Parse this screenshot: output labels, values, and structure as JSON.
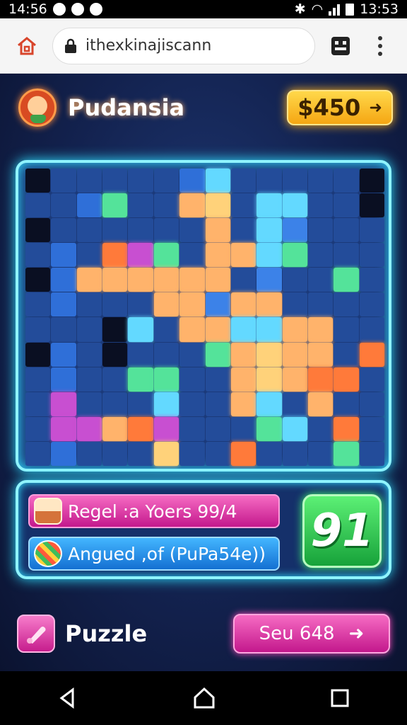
{
  "status_bar": {
    "time_left": "14:56",
    "time_right": "13:53"
  },
  "browser": {
    "url": "ithexkinajiscann"
  },
  "header": {
    "player_name": "Pudansia",
    "coins": "$450"
  },
  "panel": {
    "row1": "Regel :a Yoers 99/4",
    "row2": "Angued ,of (PuPa54e))",
    "score": "91"
  },
  "footer": {
    "puzzle_label": "Puzzle",
    "continue_label": "Seu 648"
  },
  "colors": {
    "accent": "#8ff4ff",
    "pink": "#c3188c",
    "green": "#17a23a",
    "gold": "#f5a613"
  },
  "icons": [
    "home-icon",
    "tabs-icon",
    "menu-icon",
    "lock-icon",
    "arrow-right-icon",
    "back-icon",
    "home-nav-icon",
    "recent-apps-icon"
  ]
}
